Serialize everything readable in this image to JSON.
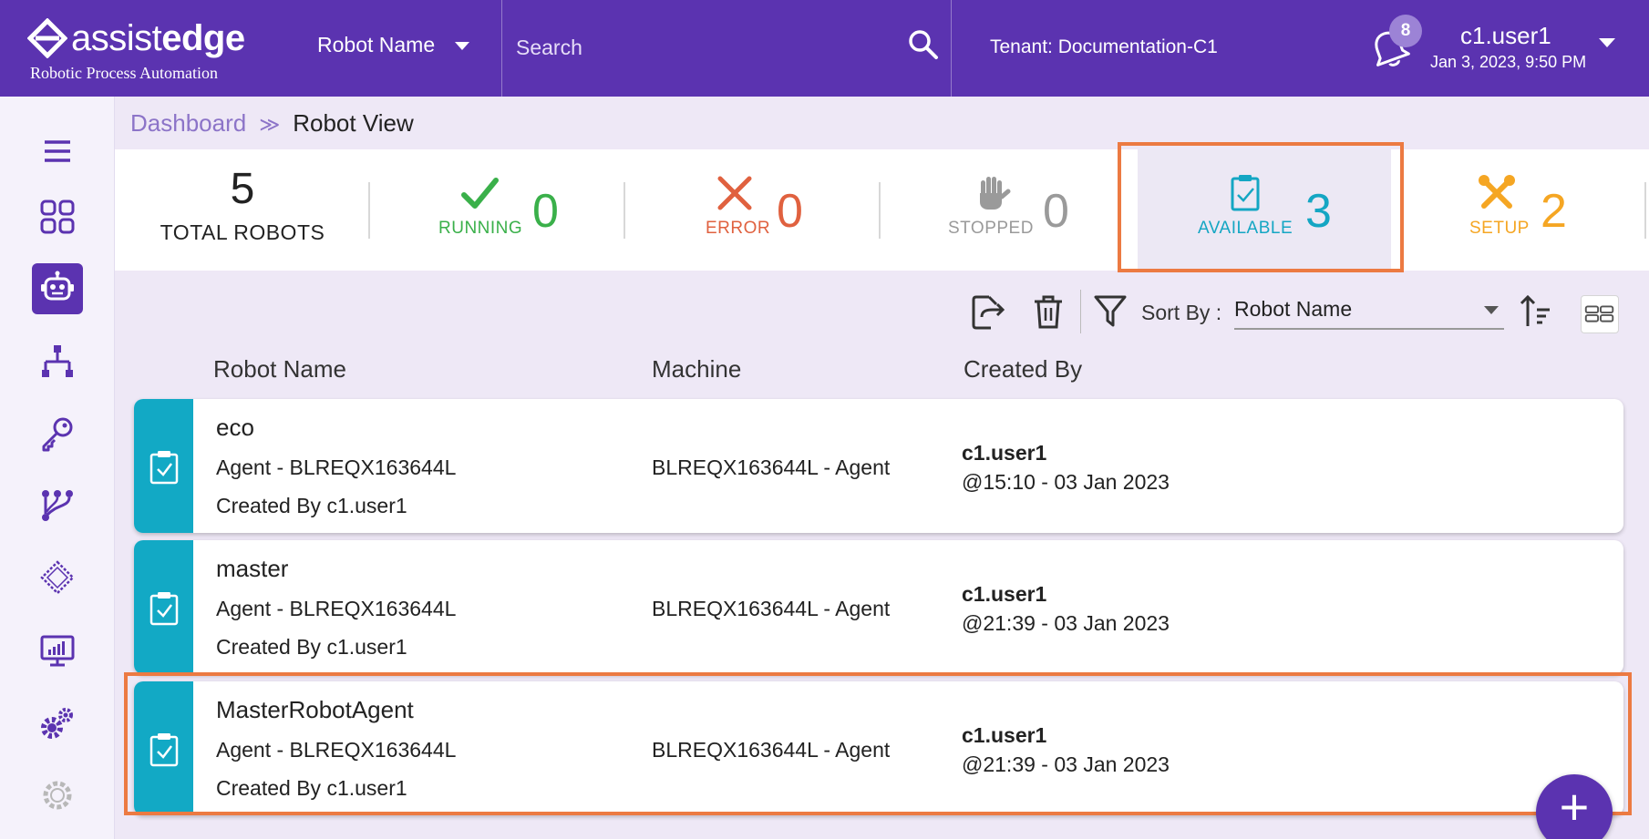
{
  "colors": {
    "brand": "#5b33b0",
    "running": "#3ab04a",
    "error": "#e0613f",
    "stopped": "#9a9a9a",
    "available": "#14a6c3",
    "setup": "#f5a623",
    "highlight": "#ec7a42"
  },
  "header": {
    "logo_light": "assist",
    "logo_bold": "edge",
    "logo_subtitle": "Robotic Process Automation",
    "search_filter": "Robot Name",
    "search_placeholder": "Search",
    "tenant": "Tenant: Documentation-C1",
    "notification_count": "8",
    "username": "c1.user1",
    "datetime": "Jan 3, 2023, 9:50 PM"
  },
  "sidebar": {
    "items": [
      {
        "icon": "menu-icon"
      },
      {
        "icon": "dashboard-grid-icon"
      },
      {
        "icon": "robot-icon",
        "active": true
      },
      {
        "icon": "hierarchy-icon"
      },
      {
        "icon": "key-icon"
      },
      {
        "icon": "workflow-icon"
      },
      {
        "icon": "chip-icon"
      },
      {
        "icon": "monitor-chart-icon"
      },
      {
        "icon": "settings-icon"
      },
      {
        "icon": "settings-outline-icon"
      }
    ]
  },
  "breadcrumb": {
    "parent": "Dashboard",
    "separator": "≫",
    "current": "Robot View"
  },
  "stats": {
    "total": {
      "value": "5",
      "label": "TOTAL ROBOTS"
    },
    "running": {
      "value": "0",
      "label": "RUNNING"
    },
    "error": {
      "value": "0",
      "label": "ERROR"
    },
    "stopped": {
      "value": "0",
      "label": "STOPPED"
    },
    "available": {
      "value": "3",
      "label": "AVAILABLE"
    },
    "setup": {
      "value": "2",
      "label": "SETUP"
    }
  },
  "toolbar": {
    "sort_label": "Sort By :",
    "sort_value": "Robot Name"
  },
  "columns": {
    "name": "Robot Name",
    "machine": "Machine",
    "created_by": "Created By"
  },
  "robots": [
    {
      "name": "eco",
      "agent": "Agent - BLREQX163644L",
      "created": "Created By c1.user1",
      "machine": "BLREQX163644L - Agent",
      "user": "c1.user1",
      "time": "@15:10 - 03 Jan 2023"
    },
    {
      "name": "master",
      "agent": "Agent - BLREQX163644L",
      "created": "Created By c1.user1",
      "machine": "BLREQX163644L - Agent",
      "user": "c1.user1",
      "time": "@21:39 - 03 Jan 2023"
    },
    {
      "name": "MasterRobotAgent",
      "agent": "Agent - BLREQX163644L",
      "created": "Created By c1.user1",
      "machine": "BLREQX163644L - Agent",
      "user": "c1.user1",
      "time": "@21:39 - 03 Jan 2023"
    }
  ],
  "fab": {
    "label": "+"
  }
}
